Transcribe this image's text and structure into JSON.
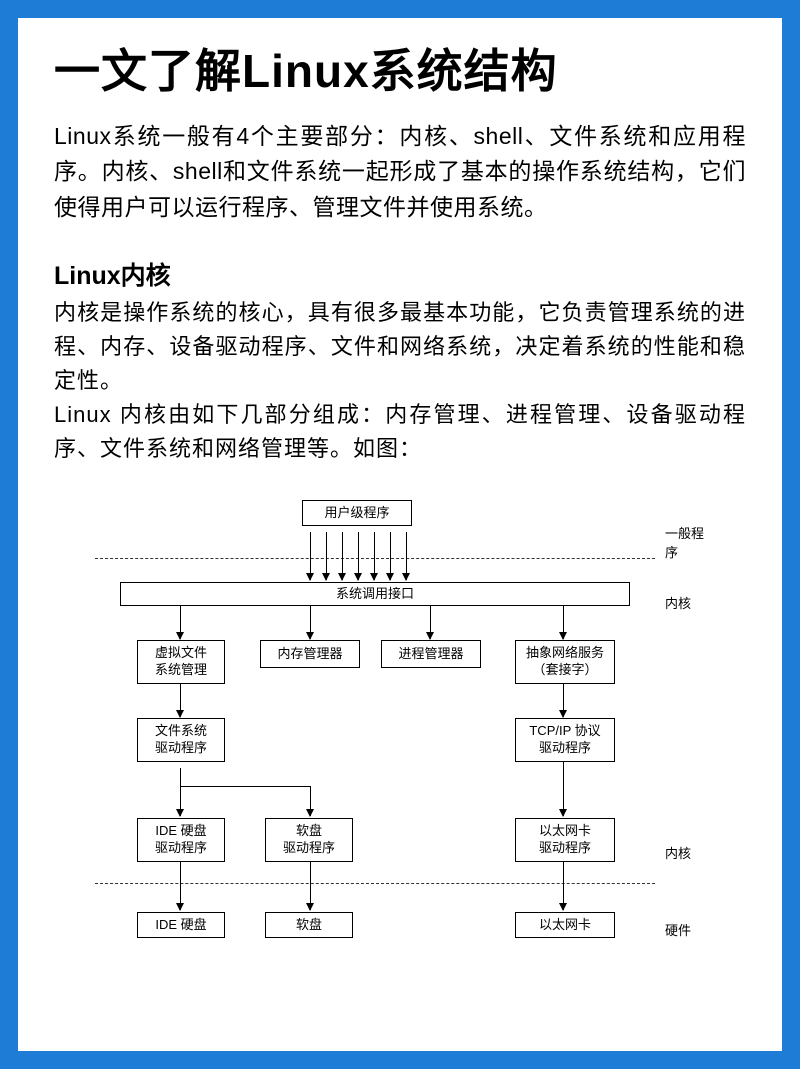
{
  "title": "一文了解Linux系统结构",
  "intro": "Linux系统一般有4个主要部分：内核、shell、文件系统和应用程序。内核、shell和文件系统一起形成了基本的操作系统结构，它们使得用户可以运行程序、管理文件并使用系统。",
  "section": {
    "heading": "Linux内核",
    "p1": "内核是操作系统的核心，具有很多最基本功能，它负责管理系统的进程、内存、设备驱动程序、文件和网络系统，决定着系统的性能和稳定性。",
    "p2": "Linux 内核由如下几部分组成：内存管理、进程管理、设备驱动程序、文件系统和网络管理等。如图："
  },
  "diagram": {
    "top_box": "用户级程序",
    "sci": "系统调用接口",
    "row2": {
      "vfs_l1": "虚拟文件",
      "vfs_l2": "系统管理",
      "mem": "内存管理器",
      "proc": "进程管理器",
      "net_l1": "抽象网络服务",
      "net_l2": "（套接字）"
    },
    "row3": {
      "fsdrv_l1": "文件系统",
      "fsdrv_l2": "驱动程序",
      "tcp_l1": "TCP/IP 协议",
      "tcp_l2": "驱动程序"
    },
    "row4": {
      "ide_l1": "IDE 硬盘",
      "ide_l2": "驱动程序",
      "floppy_l1": "软盘",
      "floppy_l2": "驱动程序",
      "eth_l1": "以太网卡",
      "eth_l2": "驱动程序"
    },
    "row5": {
      "ide_hw": "IDE 硬盘",
      "floppy_hw": "软盘",
      "eth_hw": "以太网卡"
    },
    "labels": {
      "general": "一般程序",
      "kernel": "内核",
      "hardware": "硬件"
    }
  }
}
